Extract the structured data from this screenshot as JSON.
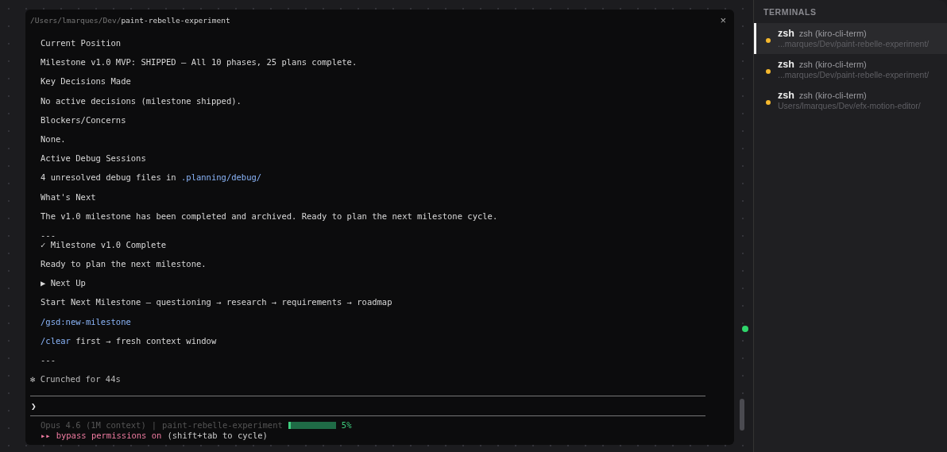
{
  "terminal": {
    "path_prefix": "/Users/lmarques/Dev/",
    "path_name": "paint-rebelle-experiment",
    "close": "×",
    "lines": [
      {
        "kind": "text",
        "segments": [
          {
            "text": "Current Position",
            "kind": "plain"
          }
        ]
      },
      {
        "kind": "text",
        "segments": [
          {
            "text": "Milestone v1.0 MVP: SHIPPED — All 10 phases, 25 plans complete.",
            "kind": "plain"
          }
        ]
      },
      {
        "kind": "text",
        "segments": [
          {
            "text": "Key Decisions Made",
            "kind": "plain"
          }
        ]
      },
      {
        "kind": "text",
        "segments": [
          {
            "text": "No active decisions (milestone shipped).",
            "kind": "plain"
          }
        ]
      },
      {
        "kind": "text",
        "segments": [
          {
            "text": "Blockers/Concerns",
            "kind": "plain"
          }
        ]
      },
      {
        "kind": "text",
        "segments": [
          {
            "text": "None.",
            "kind": "plain"
          }
        ]
      },
      {
        "kind": "text",
        "segments": [
          {
            "text": "Active Debug Sessions",
            "kind": "plain"
          }
        ]
      },
      {
        "kind": "text",
        "segments": [
          {
            "text": "4 unresolved debug files in ",
            "kind": "plain"
          },
          {
            "text": ".planning/debug/",
            "kind": "code"
          }
        ]
      },
      {
        "kind": "text",
        "segments": [
          {
            "text": "What's Next",
            "kind": "plain"
          }
        ]
      },
      {
        "kind": "text",
        "segments": [
          {
            "text": "The v1.0 milestone has been completed and archived. Ready to plan the next milestone cycle.",
            "kind": "plain"
          }
        ]
      },
      {
        "kind": "tight",
        "segments": [
          {
            "text": "---",
            "kind": "plain"
          }
        ]
      },
      {
        "kind": "text",
        "segments": [
          {
            "text": "✓ Milestone v1.0 Complete",
            "kind": "plain"
          }
        ]
      },
      {
        "kind": "text",
        "segments": [
          {
            "text": "Ready to plan the next milestone.",
            "kind": "plain"
          }
        ]
      },
      {
        "kind": "text",
        "segments": [
          {
            "text": "▶ Next Up",
            "kind": "plain"
          }
        ]
      },
      {
        "kind": "text",
        "segments": [
          {
            "text": "Start Next Milestone — questioning → research → requirements → roadmap",
            "kind": "plain"
          }
        ]
      },
      {
        "kind": "text",
        "segments": [
          {
            "text": "/gsd:new-milestone",
            "kind": "code"
          }
        ]
      },
      {
        "kind": "text",
        "segments": [
          {
            "text": "/clear",
            "kind": "code"
          },
          {
            "text": " first → fresh context window",
            "kind": "plain"
          }
        ]
      },
      {
        "kind": "text",
        "segments": [
          {
            "text": "---",
            "kind": "plain"
          }
        ]
      },
      {
        "kind": "status",
        "segments": [
          {
            "text": "✻ Crunched for 44s",
            "kind": "plain"
          }
        ]
      }
    ],
    "prompt": "❯",
    "status": {
      "model": "Opus 4.6 (1M context)",
      "separator": "|",
      "project": "paint-rebelle-experiment",
      "context": {
        "level": 0.05
      },
      "percent": "5%"
    },
    "mode": {
      "marker": "▸▸",
      "label": "bypass permissions on",
      "hint": "(shift+tab to cycle)"
    }
  },
  "sidebar": {
    "title": "TERMINALS",
    "items": [
      {
        "name": "zsh",
        "subtitle": "zsh (kiro-cli-term)",
        "path": "...marques/Dev/paint-rebelle-experiment/",
        "selected": true,
        "color": "#f5b82e"
      },
      {
        "name": "zsh",
        "subtitle": "zsh (kiro-cli-term)",
        "path": "...marques/Dev/paint-rebelle-experiment/",
        "selected": false,
        "color": "#f5b82e"
      },
      {
        "name": "zsh",
        "subtitle": "zsh (kiro-cli-term)",
        "path": "Users/lmarques/Dev/efx-motion-editor/",
        "selected": false,
        "color": "#f5b82e"
      }
    ]
  }
}
